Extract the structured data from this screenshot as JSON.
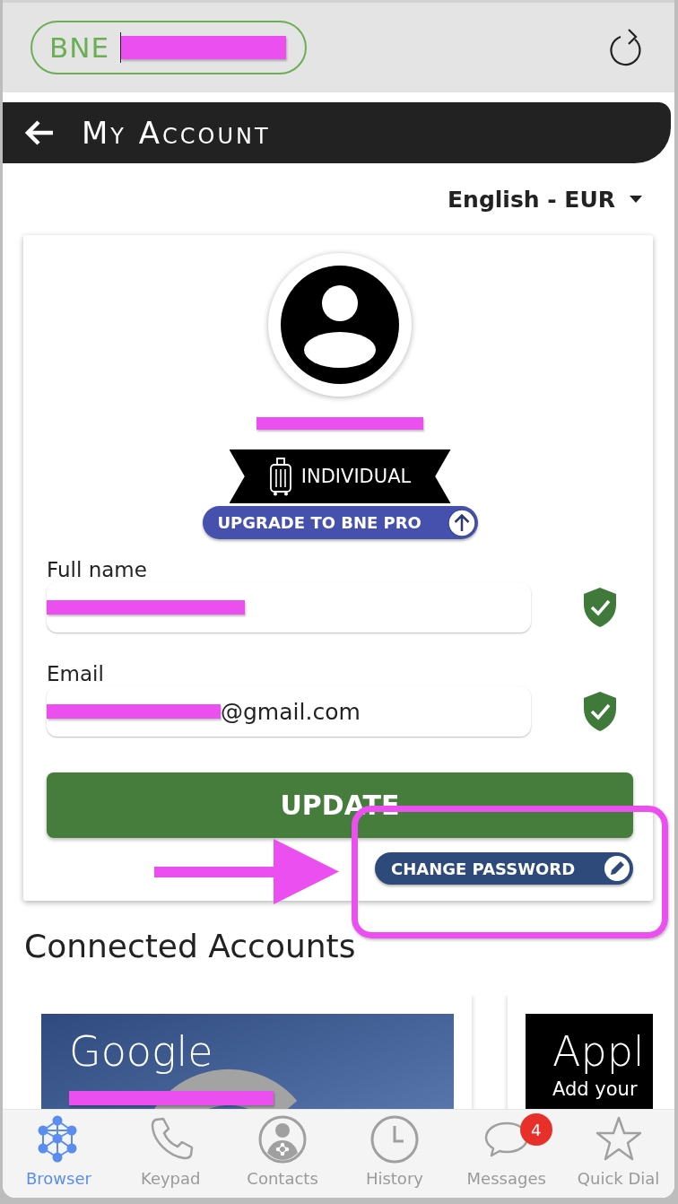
{
  "top_bar": {
    "logo": "BNE",
    "redacted": true
  },
  "header": {
    "title": "My Account"
  },
  "language": {
    "label": "English - EUR"
  },
  "profile": {
    "number_redacted": true,
    "badge": "INDIVIDUAL",
    "upgrade_button": "UPGRADE TO BNE PRO"
  },
  "fields": [
    {
      "label": "Full name",
      "redacted": true,
      "verified": true
    },
    {
      "label": "Email",
      "redacted": true,
      "value": "@gmail.com",
      "verified": true
    }
  ],
  "update_button": "UPDATE",
  "change_password_button": "CHANGE PASSWORD",
  "connected_accounts": {
    "title": "Connected Accounts",
    "accounts": [
      {
        "kind": "google",
        "name": "Google",
        "detail_redacted": true
      },
      {
        "kind": "apple",
        "name": "Appl",
        "subtitle": "Add your"
      }
    ]
  },
  "tab_bar": [
    {
      "kind": "network",
      "label": "Browser",
      "selected": true
    },
    {
      "kind": "phone",
      "label": "Keypad",
      "selected": false
    },
    {
      "kind": "contact",
      "label": "Contacts",
      "selected": false
    },
    {
      "kind": "clock",
      "label": "History",
      "selected": false
    },
    {
      "kind": "chat",
      "label": "Messages",
      "selected": false,
      "badge": "4"
    },
    {
      "kind": "star",
      "label": "Quick Dial",
      "selected": false
    }
  ]
}
